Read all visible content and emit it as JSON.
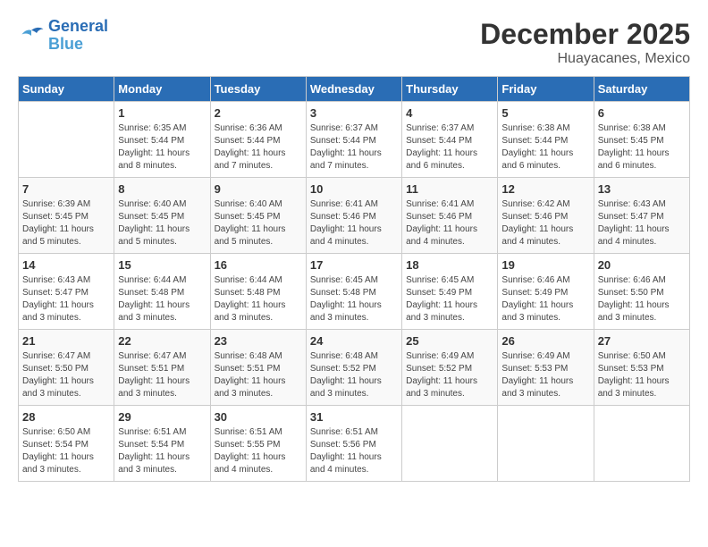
{
  "header": {
    "logo_line1": "General",
    "logo_line2": "Blue",
    "month": "December 2025",
    "location": "Huayacanes, Mexico"
  },
  "weekdays": [
    "Sunday",
    "Monday",
    "Tuesday",
    "Wednesday",
    "Thursday",
    "Friday",
    "Saturday"
  ],
  "weeks": [
    [
      {
        "day": "",
        "sunrise": "",
        "sunset": "",
        "daylight": ""
      },
      {
        "day": "1",
        "sunrise": "Sunrise: 6:35 AM",
        "sunset": "Sunset: 5:44 PM",
        "daylight": "Daylight: 11 hours and 8 minutes."
      },
      {
        "day": "2",
        "sunrise": "Sunrise: 6:36 AM",
        "sunset": "Sunset: 5:44 PM",
        "daylight": "Daylight: 11 hours and 7 minutes."
      },
      {
        "day": "3",
        "sunrise": "Sunrise: 6:37 AM",
        "sunset": "Sunset: 5:44 PM",
        "daylight": "Daylight: 11 hours and 7 minutes."
      },
      {
        "day": "4",
        "sunrise": "Sunrise: 6:37 AM",
        "sunset": "Sunset: 5:44 PM",
        "daylight": "Daylight: 11 hours and 6 minutes."
      },
      {
        "day": "5",
        "sunrise": "Sunrise: 6:38 AM",
        "sunset": "Sunset: 5:44 PM",
        "daylight": "Daylight: 11 hours and 6 minutes."
      },
      {
        "day": "6",
        "sunrise": "Sunrise: 6:38 AM",
        "sunset": "Sunset: 5:45 PM",
        "daylight": "Daylight: 11 hours and 6 minutes."
      }
    ],
    [
      {
        "day": "7",
        "sunrise": "Sunrise: 6:39 AM",
        "sunset": "Sunset: 5:45 PM",
        "daylight": "Daylight: 11 hours and 5 minutes."
      },
      {
        "day": "8",
        "sunrise": "Sunrise: 6:40 AM",
        "sunset": "Sunset: 5:45 PM",
        "daylight": "Daylight: 11 hours and 5 minutes."
      },
      {
        "day": "9",
        "sunrise": "Sunrise: 6:40 AM",
        "sunset": "Sunset: 5:45 PM",
        "daylight": "Daylight: 11 hours and 5 minutes."
      },
      {
        "day": "10",
        "sunrise": "Sunrise: 6:41 AM",
        "sunset": "Sunset: 5:46 PM",
        "daylight": "Daylight: 11 hours and 4 minutes."
      },
      {
        "day": "11",
        "sunrise": "Sunrise: 6:41 AM",
        "sunset": "Sunset: 5:46 PM",
        "daylight": "Daylight: 11 hours and 4 minutes."
      },
      {
        "day": "12",
        "sunrise": "Sunrise: 6:42 AM",
        "sunset": "Sunset: 5:46 PM",
        "daylight": "Daylight: 11 hours and 4 minutes."
      },
      {
        "day": "13",
        "sunrise": "Sunrise: 6:43 AM",
        "sunset": "Sunset: 5:47 PM",
        "daylight": "Daylight: 11 hours and 4 minutes."
      }
    ],
    [
      {
        "day": "14",
        "sunrise": "Sunrise: 6:43 AM",
        "sunset": "Sunset: 5:47 PM",
        "daylight": "Daylight: 11 hours and 3 minutes."
      },
      {
        "day": "15",
        "sunrise": "Sunrise: 6:44 AM",
        "sunset": "Sunset: 5:48 PM",
        "daylight": "Daylight: 11 hours and 3 minutes."
      },
      {
        "day": "16",
        "sunrise": "Sunrise: 6:44 AM",
        "sunset": "Sunset: 5:48 PM",
        "daylight": "Daylight: 11 hours and 3 minutes."
      },
      {
        "day": "17",
        "sunrise": "Sunrise: 6:45 AM",
        "sunset": "Sunset: 5:48 PM",
        "daylight": "Daylight: 11 hours and 3 minutes."
      },
      {
        "day": "18",
        "sunrise": "Sunrise: 6:45 AM",
        "sunset": "Sunset: 5:49 PM",
        "daylight": "Daylight: 11 hours and 3 minutes."
      },
      {
        "day": "19",
        "sunrise": "Sunrise: 6:46 AM",
        "sunset": "Sunset: 5:49 PM",
        "daylight": "Daylight: 11 hours and 3 minutes."
      },
      {
        "day": "20",
        "sunrise": "Sunrise: 6:46 AM",
        "sunset": "Sunset: 5:50 PM",
        "daylight": "Daylight: 11 hours and 3 minutes."
      }
    ],
    [
      {
        "day": "21",
        "sunrise": "Sunrise: 6:47 AM",
        "sunset": "Sunset: 5:50 PM",
        "daylight": "Daylight: 11 hours and 3 minutes."
      },
      {
        "day": "22",
        "sunrise": "Sunrise: 6:47 AM",
        "sunset": "Sunset: 5:51 PM",
        "daylight": "Daylight: 11 hours and 3 minutes."
      },
      {
        "day": "23",
        "sunrise": "Sunrise: 6:48 AM",
        "sunset": "Sunset: 5:51 PM",
        "daylight": "Daylight: 11 hours and 3 minutes."
      },
      {
        "day": "24",
        "sunrise": "Sunrise: 6:48 AM",
        "sunset": "Sunset: 5:52 PM",
        "daylight": "Daylight: 11 hours and 3 minutes."
      },
      {
        "day": "25",
        "sunrise": "Sunrise: 6:49 AM",
        "sunset": "Sunset: 5:52 PM",
        "daylight": "Daylight: 11 hours and 3 minutes."
      },
      {
        "day": "26",
        "sunrise": "Sunrise: 6:49 AM",
        "sunset": "Sunset: 5:53 PM",
        "daylight": "Daylight: 11 hours and 3 minutes."
      },
      {
        "day": "27",
        "sunrise": "Sunrise: 6:50 AM",
        "sunset": "Sunset: 5:53 PM",
        "daylight": "Daylight: 11 hours and 3 minutes."
      }
    ],
    [
      {
        "day": "28",
        "sunrise": "Sunrise: 6:50 AM",
        "sunset": "Sunset: 5:54 PM",
        "daylight": "Daylight: 11 hours and 3 minutes."
      },
      {
        "day": "29",
        "sunrise": "Sunrise: 6:51 AM",
        "sunset": "Sunset: 5:54 PM",
        "daylight": "Daylight: 11 hours and 3 minutes."
      },
      {
        "day": "30",
        "sunrise": "Sunrise: 6:51 AM",
        "sunset": "Sunset: 5:55 PM",
        "daylight": "Daylight: 11 hours and 4 minutes."
      },
      {
        "day": "31",
        "sunrise": "Sunrise: 6:51 AM",
        "sunset": "Sunset: 5:56 PM",
        "daylight": "Daylight: 11 hours and 4 minutes."
      },
      {
        "day": "",
        "sunrise": "",
        "sunset": "",
        "daylight": ""
      },
      {
        "day": "",
        "sunrise": "",
        "sunset": "",
        "daylight": ""
      },
      {
        "day": "",
        "sunrise": "",
        "sunset": "",
        "daylight": ""
      }
    ]
  ]
}
